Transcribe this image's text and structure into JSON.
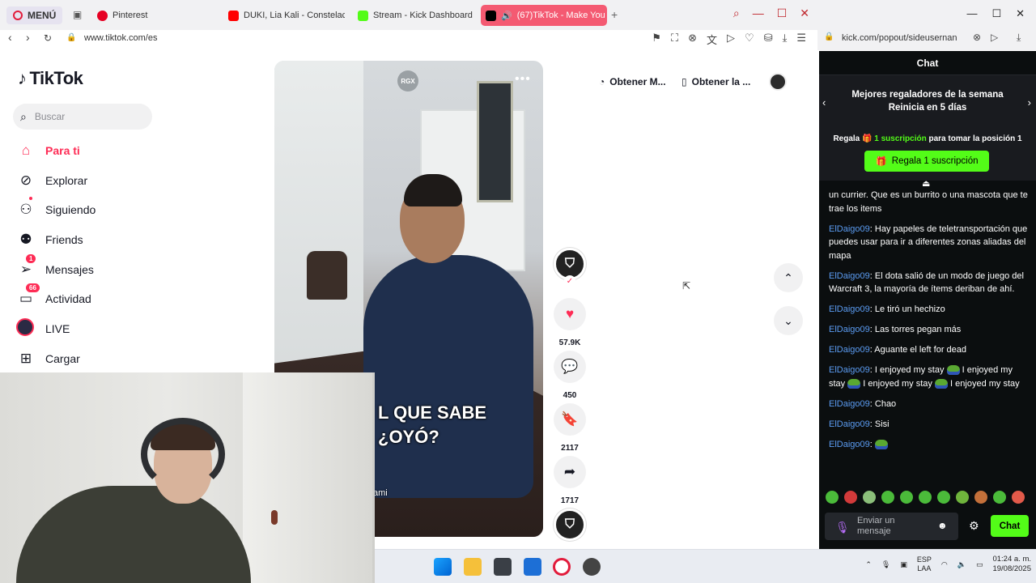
{
  "browser": {
    "menu_label": "MENÚ",
    "tabs": [
      {
        "label": "Pinterest",
        "color": "#e60023"
      },
      {
        "label": "DUKI, Lia Kali - Constelac",
        "color": "#ff0000"
      },
      {
        "label": "Stream - Kick Dashboard",
        "color": "#53fc18"
      },
      {
        "label": "(67)TikTok - Make You",
        "color": "#000000"
      }
    ],
    "url": "www.tiktok.com/es"
  },
  "tiktok": {
    "logo": "TikTok",
    "search_placeholder": "Buscar",
    "nav": [
      {
        "label": "Para ti",
        "icon": "home-icon"
      },
      {
        "label": "Explorar",
        "icon": "compass-icon"
      },
      {
        "label": "Siguiendo",
        "icon": "following-icon"
      },
      {
        "label": "Friends",
        "icon": "friends-icon"
      },
      {
        "label": "Mensajes",
        "icon": "messages-icon",
        "badge": "1"
      },
      {
        "label": "Actividad",
        "icon": "activity-icon",
        "badge": "66"
      },
      {
        "label": "LIVE",
        "icon": "live-icon"
      },
      {
        "label": "Cargar",
        "icon": "upload-icon"
      }
    ],
    "top_links": [
      "Obtener M...",
      "Obtener la ..."
    ],
    "video": {
      "watermark": "RGX",
      "caption_line1": "L QUE SABE",
      "caption_line2": "¿OYÓ?",
      "tag": "ami"
    },
    "actions": {
      "likes": "57.9K",
      "comments": "450",
      "saves": "2117",
      "shares": "1717"
    }
  },
  "kick": {
    "url": "kick.com/popout/sideusernan",
    "chat_title": "Chat",
    "gifters_title": "Mejores regaladores de la semana",
    "gifters_sub": "Reinicia en 5 días",
    "gift_prefix": "Regala",
    "gift_count": "1 suscripción",
    "gift_suffix": "para tomar la posición 1",
    "gift_button": "Regala 1 suscripción",
    "messages": [
      {
        "user": "",
        "text": "un currier. Que es un burrito o una mascota que te trae los items"
      },
      {
        "user": "ElDaigo09",
        "text": ": Hay papeles de teletransportación que puedes usar para ir a diferentes zonas aliadas del mapa"
      },
      {
        "user": "ElDaigo09",
        "text": ": El dota salió de un modo de juego del Warcraft 3, la mayoría de ítems deriban de ahí."
      },
      {
        "user": "ElDaigo09",
        "text": ": Le tiró un hechizo"
      },
      {
        "user": "ElDaigo09",
        "text": ": Las torres pegan más"
      },
      {
        "user": "ElDaigo09",
        "text": ": Aguante el left for dead"
      },
      {
        "user": "ElDaigo09",
        "text": ": I enjoyed my stay",
        "rest1": " I enjoyed my stay",
        "rest2": " I enjoyed my stay",
        "rest3": " enjoyed my stay"
      },
      {
        "user": "ElDaigo09",
        "text": ": Chao"
      },
      {
        "user": "ElDaigo09",
        "text": ": Sisi"
      },
      {
        "user": "ElDaigo09",
        "text": ":"
      }
    ],
    "input_placeholder": "Enviar un mensaje",
    "send_label": "Chat",
    "accent": "#53fc18",
    "username_color": "#5b9cf2"
  },
  "taskbar": {
    "lang": "ESP",
    "lang_sub": "LAA",
    "time": "01:24 a. m.",
    "date": "19/08/2025"
  }
}
